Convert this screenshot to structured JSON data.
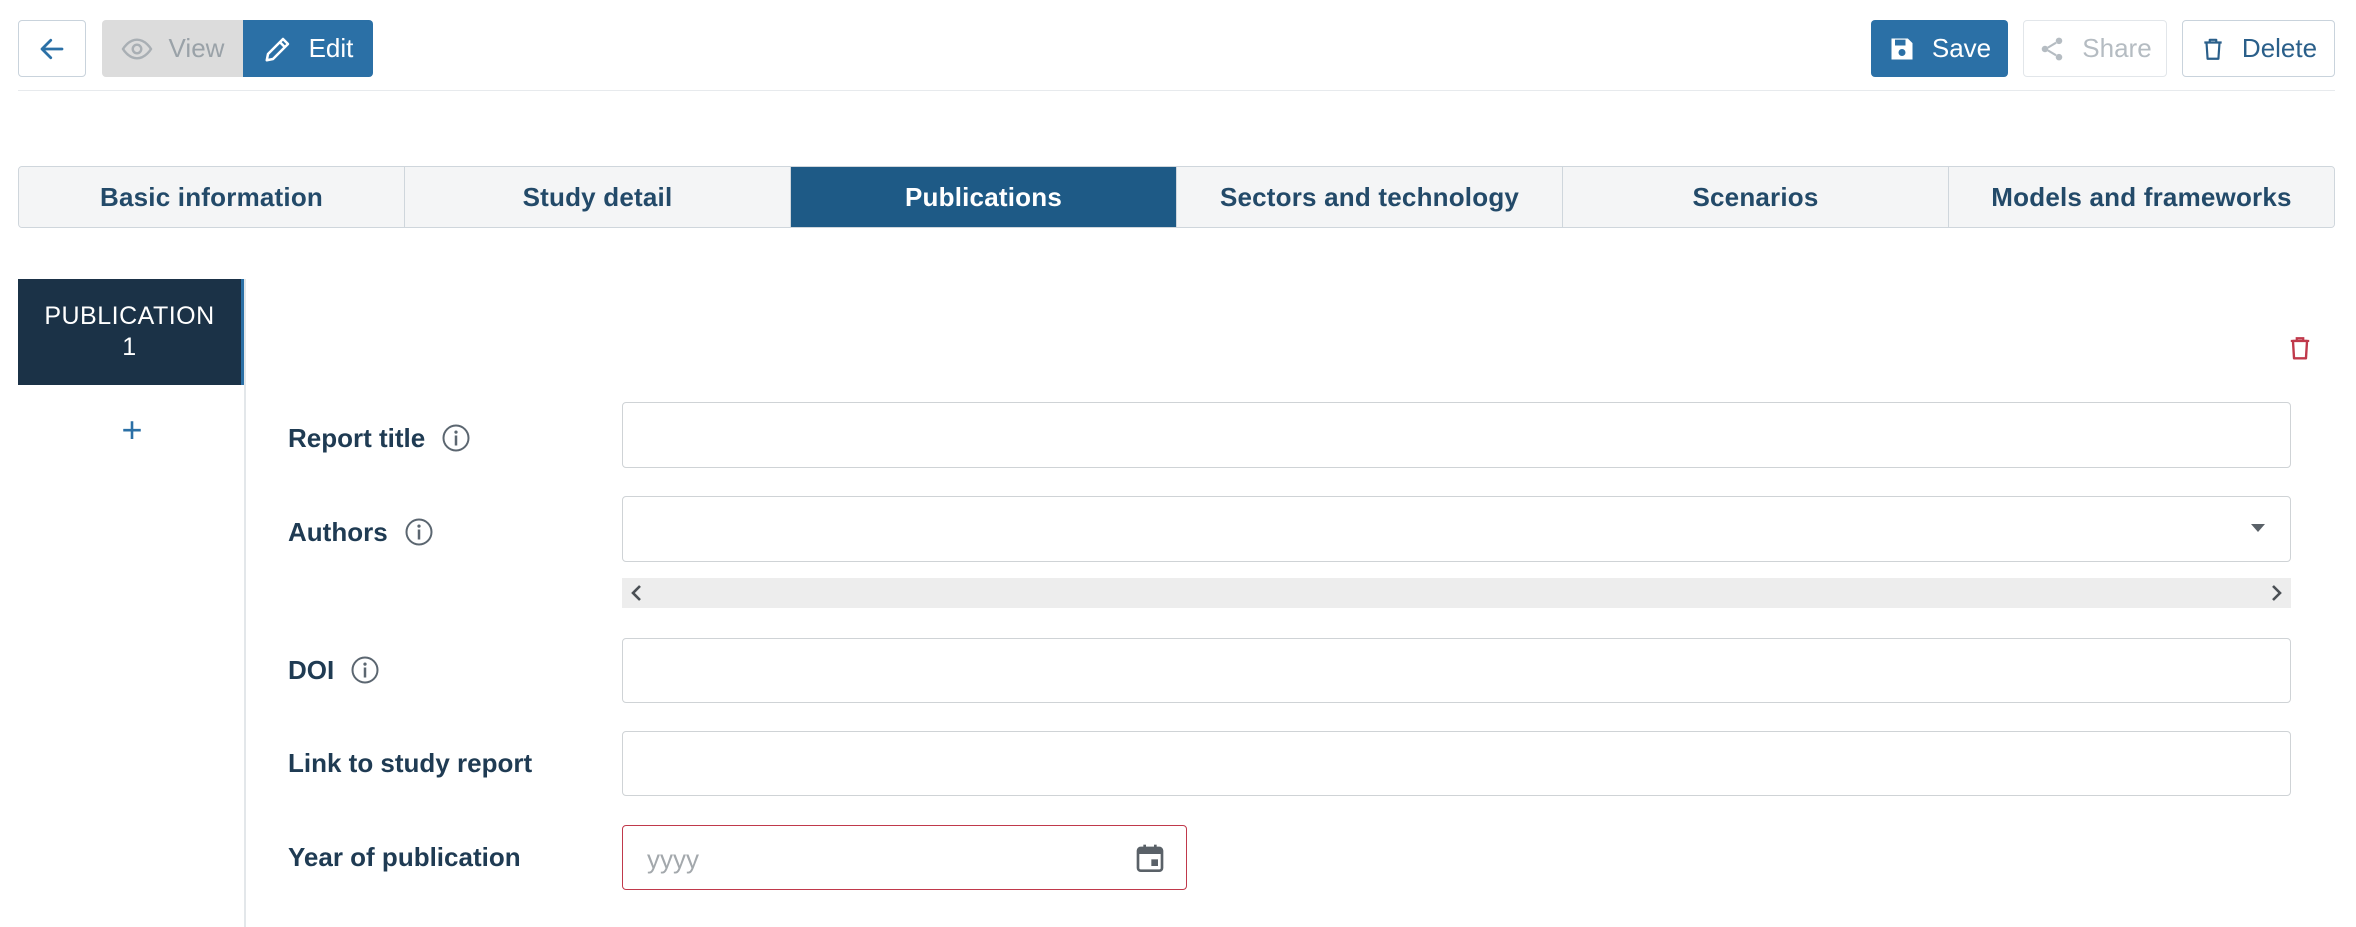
{
  "toolbar": {
    "view_label": "View",
    "edit_label": "Edit",
    "save_label": "Save",
    "share_label": "Share",
    "delete_label": "Delete"
  },
  "tabs": [
    {
      "label": "Basic information",
      "active": false
    },
    {
      "label": "Study detail",
      "active": false
    },
    {
      "label": "Publications",
      "active": true
    },
    {
      "label": "Sectors and technology",
      "active": false
    },
    {
      "label": "Scenarios",
      "active": false
    },
    {
      "label": "Models and frameworks",
      "active": false
    }
  ],
  "publications": {
    "items": [
      {
        "label_line1": "PUBLICATION",
        "label_line2": "1"
      }
    ],
    "add_label": "+"
  },
  "form": {
    "report_title": {
      "label": "Report title",
      "value": ""
    },
    "authors": {
      "label": "Authors",
      "value": ""
    },
    "doi": {
      "label": "DOI",
      "value": ""
    },
    "link": {
      "label": "Link to study report",
      "value": ""
    },
    "year": {
      "label": "Year of publication",
      "placeholder": "yyyy",
      "value": ""
    }
  },
  "colors": {
    "primary": "#2b70a6",
    "active_tab": "#1e5a86",
    "nav_dark": "#1b3247",
    "danger": "#c0394b"
  },
  "icons": {
    "back": "arrow-left-icon",
    "view": "eye-icon",
    "edit": "pencil-icon",
    "save": "floppy-disk-icon",
    "share": "share-icon",
    "delete": "trash-icon",
    "info": "info-circle-icon",
    "calendar": "calendar-icon",
    "dropdown": "caret-down-icon"
  }
}
